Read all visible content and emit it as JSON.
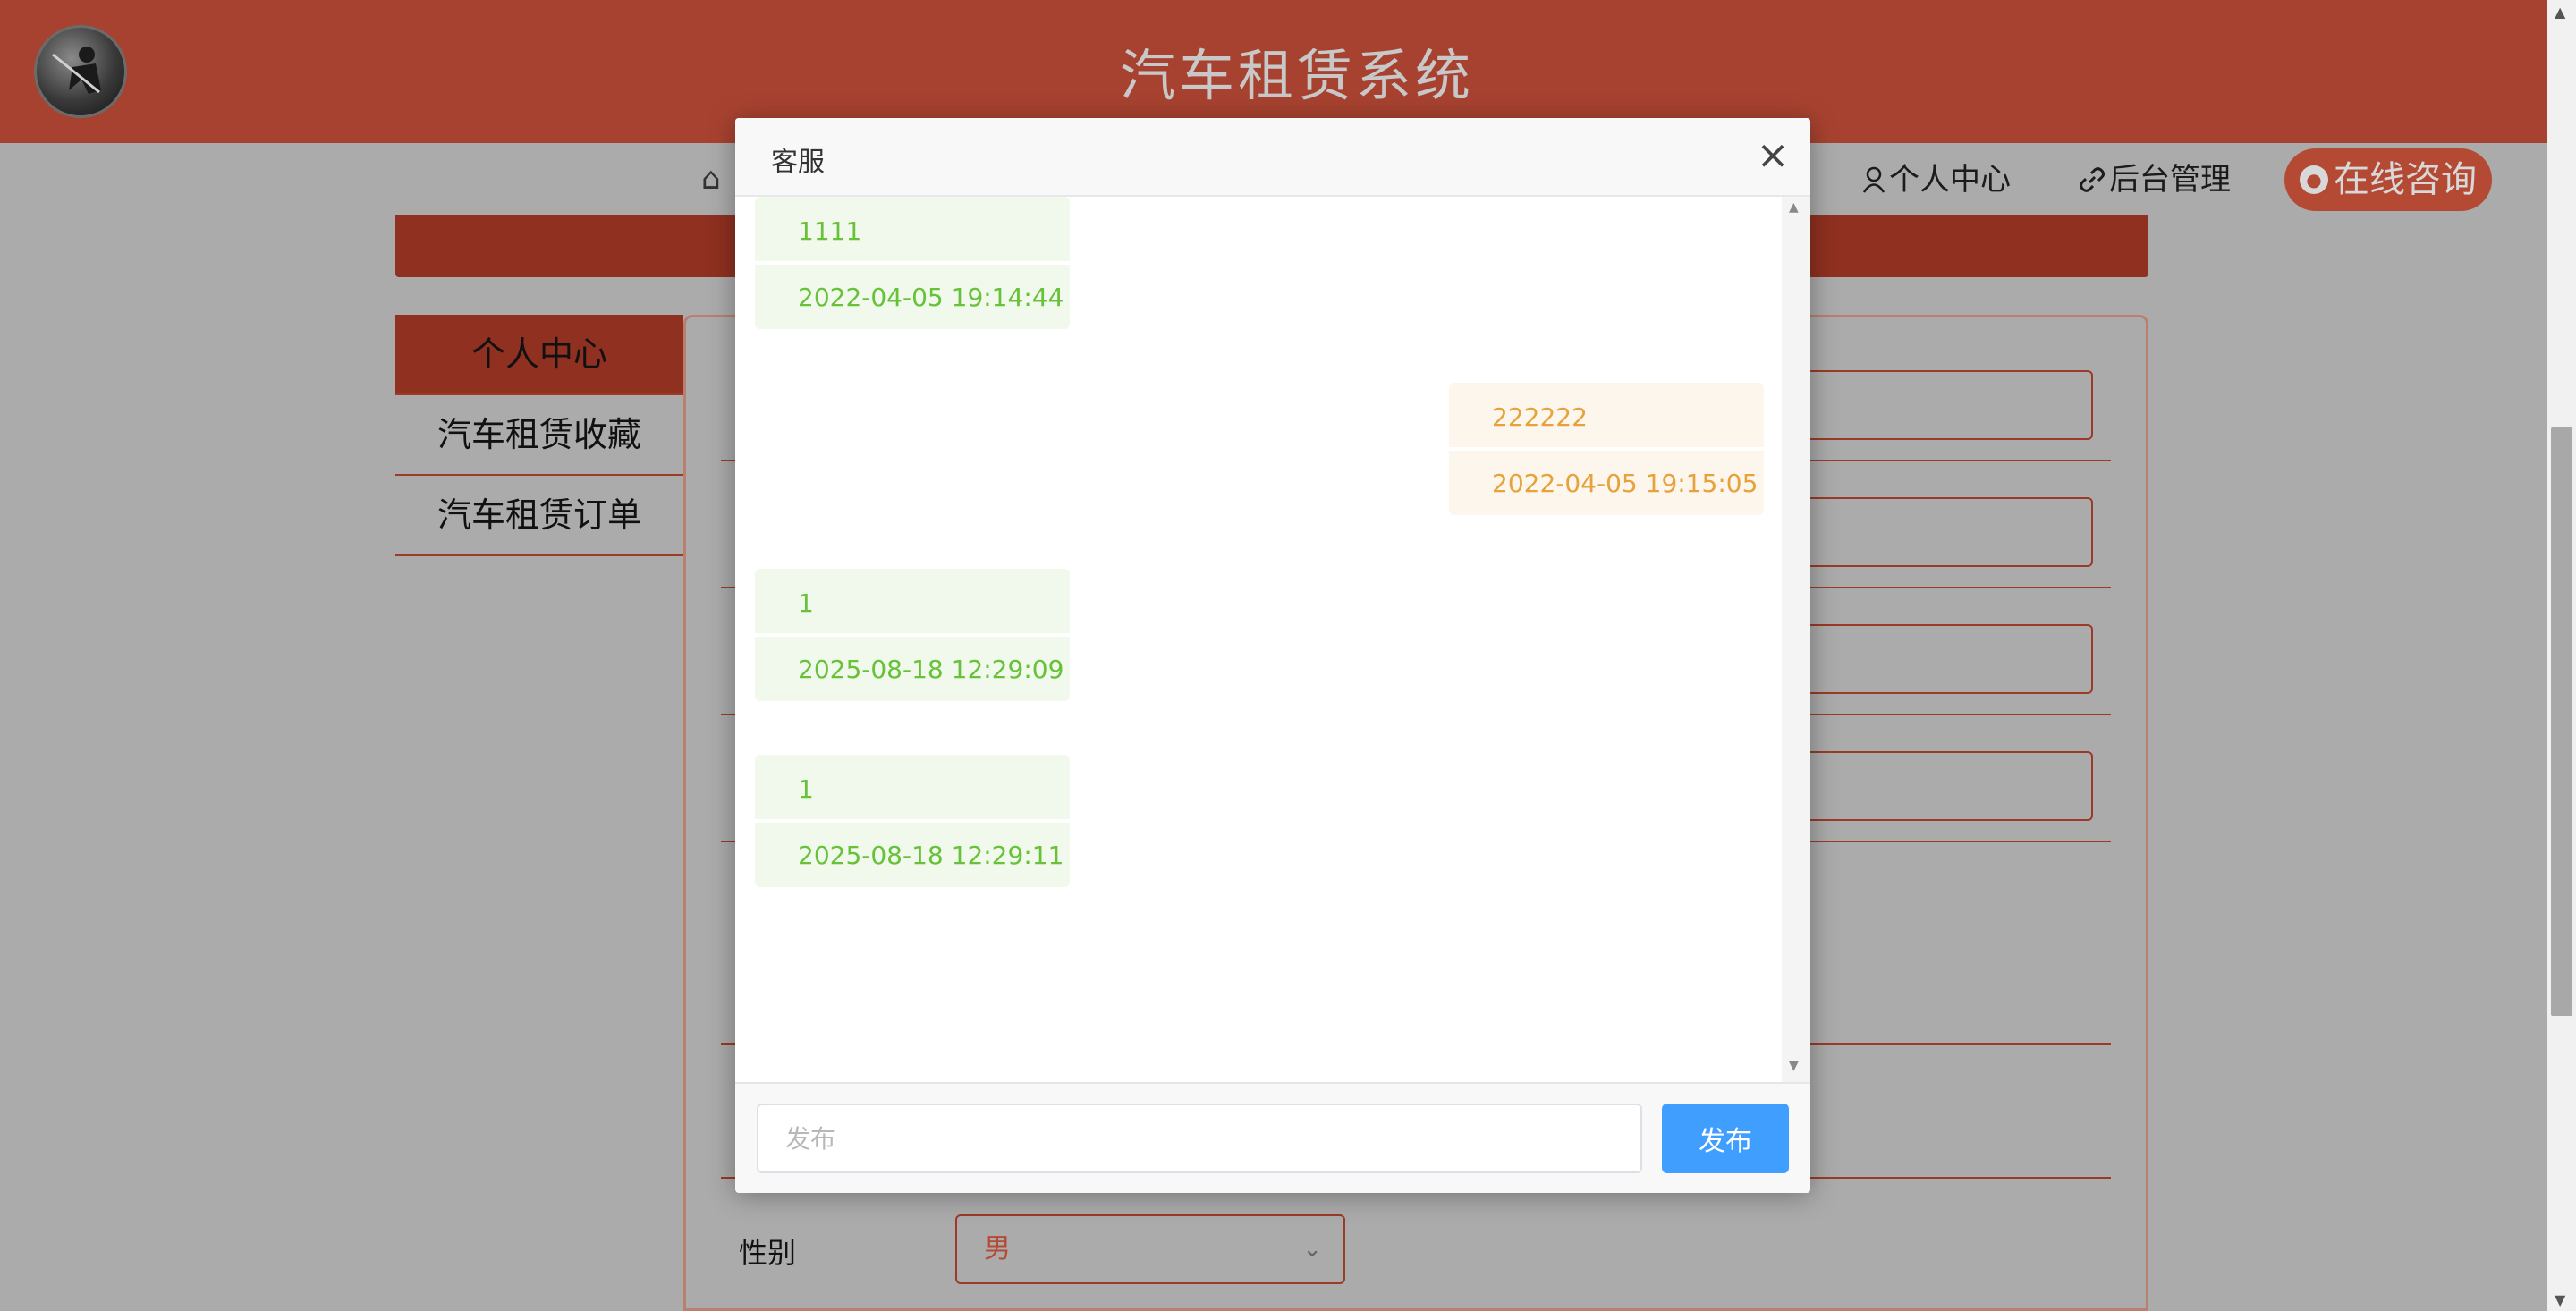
{
  "header": {
    "title": "汽车租赁系统"
  },
  "nav": {
    "items": [
      {
        "label": "个人中心"
      },
      {
        "label": "后台管理"
      }
    ],
    "online_consult": "在线咨询"
  },
  "sidebar": {
    "items": [
      {
        "label": "个人中心",
        "active": true
      },
      {
        "label": "汽车租赁收藏"
      },
      {
        "label": "汽车租赁订单"
      }
    ]
  },
  "form": {
    "gender_label": "性别",
    "gender_value": "男"
  },
  "dialog": {
    "title": "客服",
    "messages": [
      {
        "side": "left",
        "text": "1111",
        "time": "2022-04-05 19:14:44"
      },
      {
        "side": "right",
        "text": "222222",
        "time": "2022-04-05 19:15:05"
      },
      {
        "side": "left",
        "text": "1",
        "time": "2025-08-18 12:29:09"
      },
      {
        "side": "left",
        "text": "1",
        "time": "2025-08-18 12:29:11"
      }
    ],
    "input_placeholder": "发布",
    "send_label": "发布"
  },
  "colors": {
    "brand": "#a84230",
    "user_bubble_bg": "#f0f9eb",
    "user_bubble_text": "#67c23a",
    "service_bubble_bg": "#fdf6ec",
    "service_bubble_text": "#e6a23c",
    "primary_button": "#409eff"
  }
}
